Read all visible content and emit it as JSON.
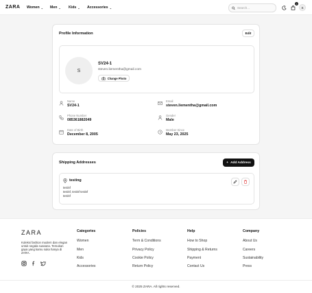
{
  "header": {
    "logo": "ZARA",
    "nav": [
      "Women",
      "Men",
      "Kids",
      "Accessories"
    ],
    "search_placeholder": "Search...",
    "cart_count": "0",
    "avatar_initial": "S"
  },
  "profile": {
    "title": "Profile Information",
    "edit_label": "Edit",
    "avatar_initial": "S",
    "name": "SV24-1",
    "email": "steven.liementha@gmail.com",
    "change_photo_label": "Change Photo",
    "fields": {
      "name": {
        "label": "Name",
        "value": "SV24-1"
      },
      "email": {
        "label": "Email",
        "value": "steven.liementha@gmail.com"
      },
      "phone": {
        "label": "Phone Number",
        "value": "085361882049"
      },
      "gender": {
        "label": "Gender",
        "value": "Male"
      },
      "dob": {
        "label": "Date of Birth",
        "value": "December 8, 2005"
      },
      "member_since": {
        "label": "Member Since",
        "value": "May 23, 2025"
      }
    }
  },
  "shipping": {
    "title": "Shipping Addresses",
    "add_label": "Add Address",
    "addresses": [
      {
        "name": "testing",
        "lines": [
          "testinf",
          "testinf, testinf testinf",
          "testinf"
        ]
      }
    ]
  },
  "footer": {
    "logo": "ZARA",
    "description": "Koleksi fashion modern dan elegan untuk segala suasana. Temukan gaya yang kamu suka hanya di ZARA.",
    "columns": [
      {
        "heading": "Categories",
        "links": [
          "Women",
          "Men",
          "Kids",
          "Accessories"
        ]
      },
      {
        "heading": "Policies",
        "links": [
          "Term & Conditions",
          "Privacy Policy",
          "Cookie Policy",
          "Return Policy"
        ]
      },
      {
        "heading": "Help",
        "links": [
          "How to Shop",
          "Shipping & Returns",
          "Payment",
          "Contact Us"
        ]
      },
      {
        "heading": "Company",
        "links": [
          "About Us",
          "Careers",
          "Sustainability",
          "Press"
        ]
      }
    ],
    "copyright": "© 2025 ZARA. All rights reserved."
  }
}
